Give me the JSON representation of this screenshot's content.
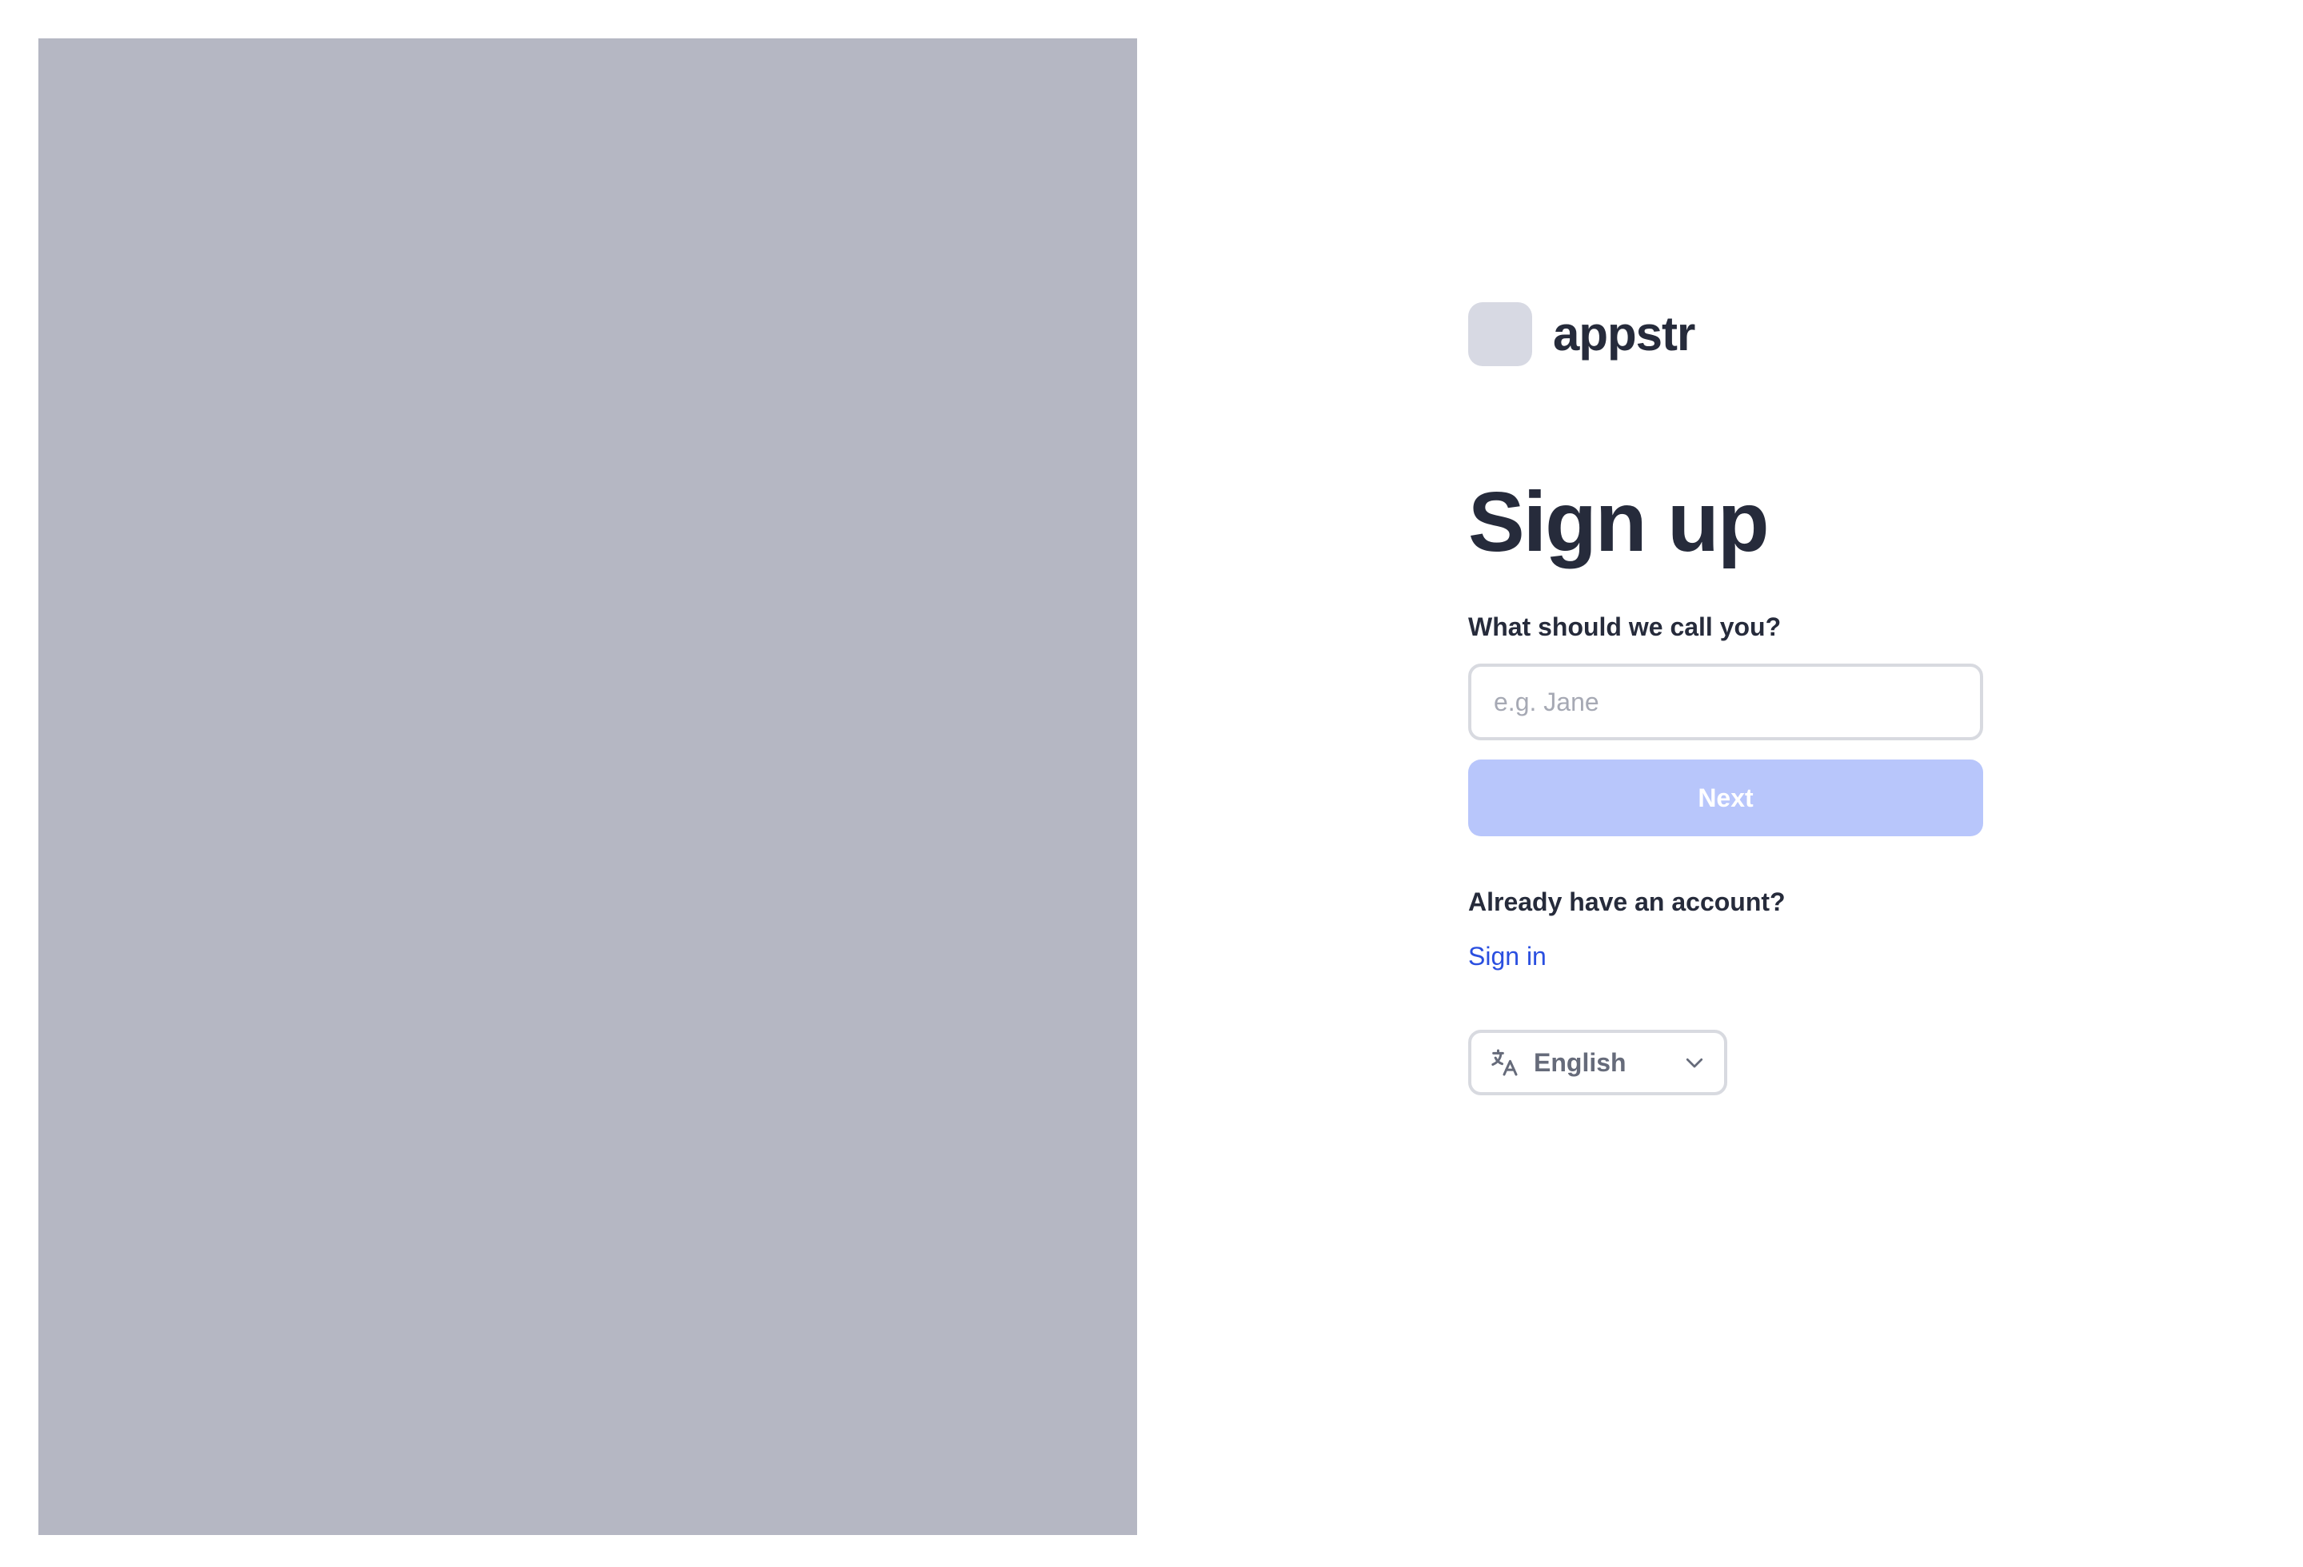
{
  "app": {
    "name": "appstr"
  },
  "signup": {
    "title": "Sign up",
    "name_label": "What should we call you?",
    "name_value": "",
    "name_placeholder": "e.g. Jane",
    "next_label": "Next"
  },
  "account": {
    "prompt": "Already have an account?",
    "signin_label": "Sign in"
  },
  "language": {
    "icon": "translate-icon",
    "selected": "English",
    "chevron": "chevron-down-icon"
  },
  "colors": {
    "side_panel": "#b5b7c3",
    "logo_placeholder": "#d7d9e3",
    "text_primary": "#262b3b",
    "button_disabled": "#b8c6fb",
    "link": "#2a4fe0",
    "border": "#d8dae0",
    "muted_text": "#666b7a"
  }
}
